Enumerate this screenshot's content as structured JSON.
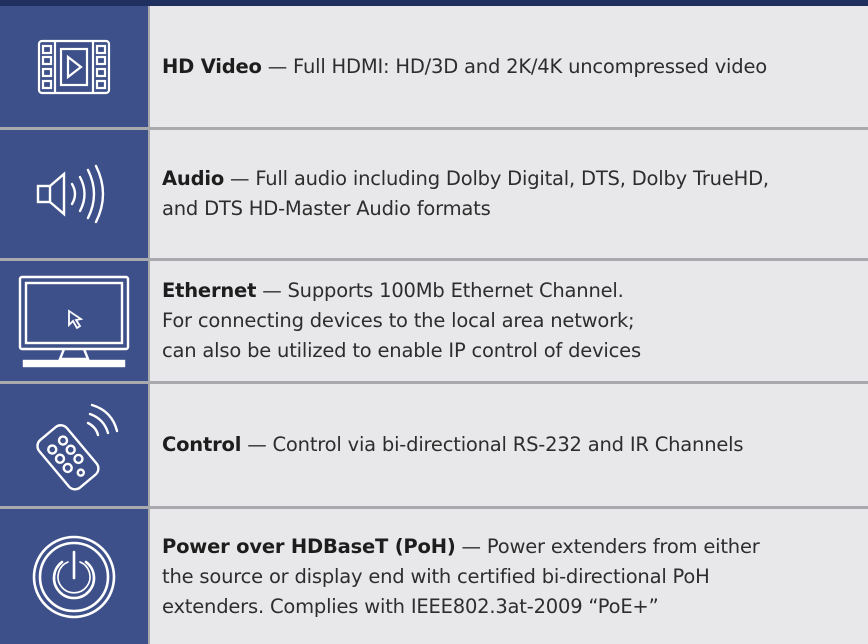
{
  "rows": [
    {
      "icon": "film-play-icon",
      "title": "HD Video",
      "text": " — Full HDMI: HD/3D and 2K/4K uncompressed video"
    },
    {
      "icon": "speaker-volume-icon",
      "title": "Audio",
      "text": " — Full audio including Dolby Digital, DTS, Dolby TrueHD,",
      "text2": "and DTS HD-Master Audio formats"
    },
    {
      "icon": "monitor-cursor-icon",
      "title": "Ethernet",
      "text": " — Supports 100Mb Ethernet Channel.",
      "text2": "For connecting devices to the local area network;",
      "text3": "can also be utilized to enable IP control of devices"
    },
    {
      "icon": "remote-control-icon",
      "title": "Control",
      "text": " — Control via bi-directional RS-232 and IR Channels"
    },
    {
      "icon": "power-icon",
      "title": "Power over HDBaseT (PoH)",
      "text": " — Power extenders from either",
      "text2": "the source or display end with certified bi-directional PoH",
      "text3": "extenders. Complies with IEEE802.3at-2009 “PoE+”"
    }
  ],
  "colors": {
    "icon_bg": "#3e5089",
    "text_bg": "#e8e8ea",
    "top_bar": "#1f2f5f",
    "separator": "#a9aaae"
  }
}
